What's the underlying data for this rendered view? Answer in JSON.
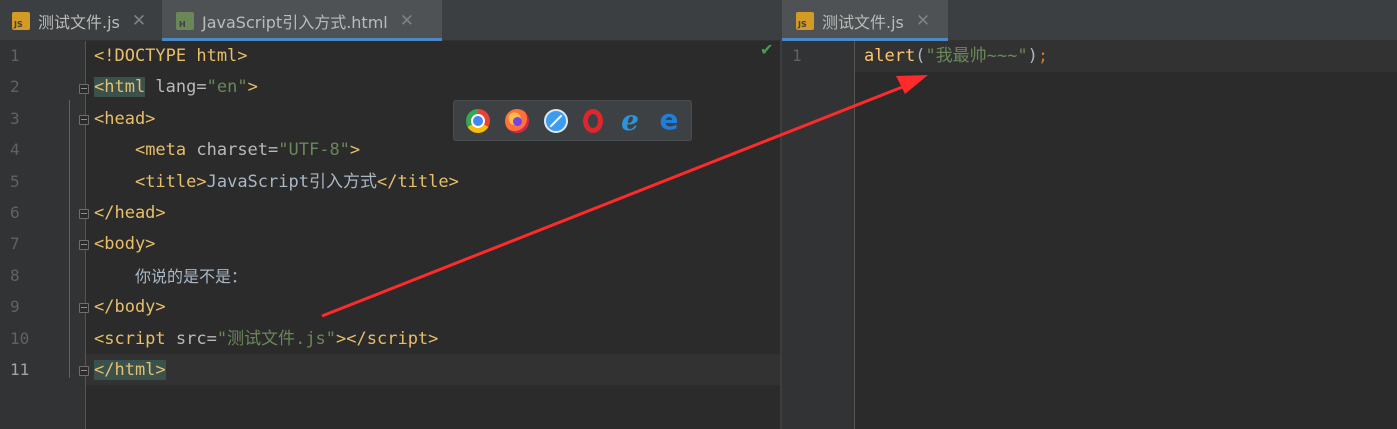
{
  "left_tabs": [
    {
      "label": "测试文件.js",
      "icon": "js-file-icon",
      "active": false
    },
    {
      "label": "JavaScript引入方式.html",
      "icon": "html-file-icon",
      "active": true
    }
  ],
  "right_tabs": [
    {
      "label": "测试文件.js",
      "icon": "js-file-icon",
      "active": true
    }
  ],
  "file_icon_text": {
    "js": "JS",
    "html": "H"
  },
  "close_glyph": "✕",
  "left_editor": {
    "line_numbers": [
      "1",
      "2",
      "3",
      "4",
      "5",
      "6",
      "7",
      "8",
      "9",
      "10",
      "11"
    ],
    "current_line": "11",
    "lines": [
      {
        "parts": [
          {
            "t": "<!DOCTYPE html>",
            "c": "tag"
          }
        ]
      },
      {
        "parts": [
          {
            "t": "<html",
            "c": "tag",
            "bg": true
          },
          {
            "t": " lang=",
            "c": "attr"
          },
          {
            "t": "\"en\"",
            "c": "str"
          },
          {
            "t": ">",
            "c": "tag"
          }
        ]
      },
      {
        "parts": [
          {
            "t": "<head>",
            "c": "tag"
          }
        ]
      },
      {
        "parts": [
          {
            "t": "    ",
            "c": "attr"
          },
          {
            "t": "<meta",
            "c": "tag"
          },
          {
            "t": " charset=",
            "c": "attr"
          },
          {
            "t": "\"UTF-8\"",
            "c": "str"
          },
          {
            "t": ">",
            "c": "tag"
          }
        ]
      },
      {
        "parts": [
          {
            "t": "    ",
            "c": "attr"
          },
          {
            "t": "<title>",
            "c": "tag"
          },
          {
            "t": "JavaScript引入方式",
            "c": "punc"
          },
          {
            "t": "</title>",
            "c": "tag"
          }
        ]
      },
      {
        "parts": [
          {
            "t": "</head>",
            "c": "tag"
          }
        ]
      },
      {
        "parts": [
          {
            "t": "<body>",
            "c": "tag"
          }
        ]
      },
      {
        "parts": [
          {
            "t": "    ",
            "c": "attr"
          },
          {
            "t": "你说的是不是：",
            "c": "txt"
          }
        ]
      },
      {
        "parts": [
          {
            "t": "</body>",
            "c": "tag"
          }
        ]
      },
      {
        "parts": [
          {
            "t": "<script",
            "c": "tag"
          },
          {
            "t": " src=",
            "c": "attr"
          },
          {
            "t": "\"测试文件.js\"",
            "c": "str"
          },
          {
            "t": "></",
            "c": "tag"
          },
          {
            "t": "script>",
            "c": "tag"
          }
        ]
      },
      {
        "parts": [
          {
            "t": "</html>",
            "c": "tag",
            "bg": true
          }
        ]
      }
    ]
  },
  "right_editor": {
    "line_numbers": [
      "1"
    ],
    "lines": [
      {
        "parts": [
          {
            "t": "alert",
            "c": "fn"
          },
          {
            "t": "(",
            "c": "punc"
          },
          {
            "t": "\"我最帅~~~\"",
            "c": "str"
          },
          {
            "t": ")",
            "c": "punc"
          },
          {
            "t": ";",
            "c": "semi"
          }
        ]
      }
    ]
  },
  "inspection_status": "✔",
  "browser_icons": [
    "chrome-icon",
    "firefox-icon",
    "safari-icon",
    "opera-icon",
    "ie-icon",
    "edge-icon"
  ],
  "browser_glyphs": {
    "ie": "e",
    "edge": "e"
  },
  "colors": {
    "arrow": "#ff2a2a",
    "tag": "#e8bf6a",
    "string": "#6a8759",
    "function": "#ffc66d",
    "accent": "#4a88c7"
  }
}
